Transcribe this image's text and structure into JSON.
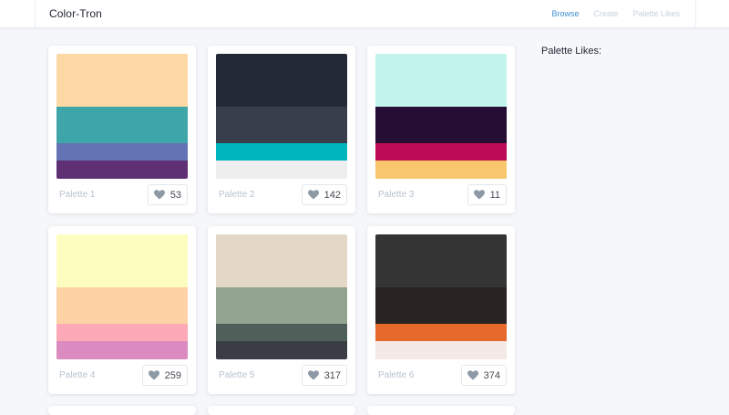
{
  "header": {
    "brand": "Color-Tron",
    "nav": [
      {
        "label": "Browse",
        "active": true
      },
      {
        "label": "Create",
        "active": false
      },
      {
        "label": "Palette Likes",
        "active": false
      }
    ]
  },
  "sidebar": {
    "title": "Palette Likes:"
  },
  "palettes": [
    {
      "name": "Palette 1",
      "likes": "53",
      "colors": [
        "#fcd9a4",
        "#3ea6a9",
        "#6473b4",
        "#5f3074"
      ]
    },
    {
      "name": "Palette 2",
      "likes": "142",
      "colors": [
        "#232a35",
        "#393f4a",
        "#00b6be",
        "#eeeeee"
      ]
    },
    {
      "name": "Palette 3",
      "likes": "11",
      "colors": [
        "#c2f4ec",
        "#260d34",
        "#bd0c55",
        "#f8c66c"
      ]
    },
    {
      "name": "Palette 4",
      "likes": "259",
      "colors": [
        "#fefdc0",
        "#fdd2a5",
        "#fda9b8",
        "#db8bbf"
      ]
    },
    {
      "name": "Palette 5",
      "likes": "317",
      "colors": [
        "#e3d8c8",
        "#93a590",
        "#4f5f5a",
        "#3a3d45"
      ]
    },
    {
      "name": "Palette 6",
      "likes": "374",
      "colors": [
        "#353434",
        "#292322",
        "#e76a2d",
        "#f4e9e6"
      ]
    }
  ],
  "icons": {
    "like": "heart-icon"
  }
}
